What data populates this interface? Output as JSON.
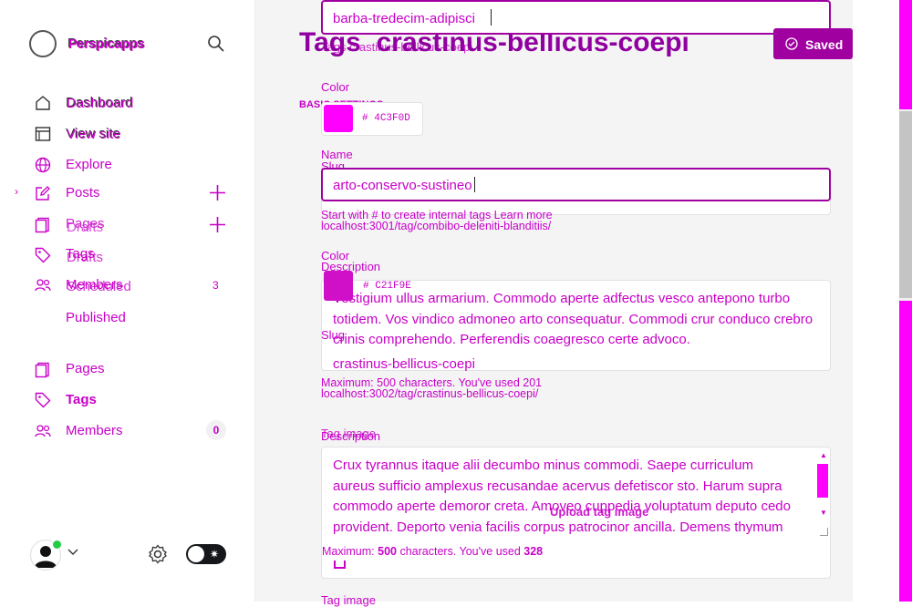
{
  "app": {
    "name": "Perspicapps"
  },
  "nav": {
    "dashboard": "Dashboard",
    "view_site": "View site",
    "explore": "Explore",
    "posts": "Posts",
    "pages_ghost": "Pages",
    "drafts": "Drafts",
    "tags_ghost": "Tags",
    "scheduled": "Scheduled",
    "members_ghost": "Members",
    "members_ghost_count": "3",
    "published": "Published",
    "pages": "Pages",
    "tags": "Tags",
    "members": "Members",
    "members_count": "0"
  },
  "header": {
    "title": "Tags  crastinus-bellicus-coepi",
    "breadcrumb_ghost": "Tags  crastinus-bellicus-coepi",
    "saved_label": "Saved",
    "basic_settings": "BASIC SETTINGS"
  },
  "top_input": {
    "value": "barba-tredecim-adipisci"
  },
  "ghost_form": {
    "color_label": "Color",
    "color_hex": "4C3F0D",
    "name_label": "Name",
    "name_value": "arto-conservo-sustineo",
    "hint": "Start with # to create internal tags Learn more",
    "slug_label": "Slug",
    "slug_value": "combibo-deleniti-blanditiis",
    "slug_url": "localhost:3001/tag/combibo-deleniti-blanditiis/",
    "color2_label": "Color",
    "color2_hex": "C21F9E",
    "tag_image_label": "Tag image",
    "upload_label": "Upload tag image"
  },
  "form": {
    "description_label": "Description",
    "description_text_1": "Vestigium ullus armarium. Commodo aperte adfectus vesco antepono turbo totidem. Vos vindico admoneo arto consequatur. Commodi crur conduco crebro crinis comprehendo. Perferendis coaegresco certe advoco.",
    "max_chars": "Maximum: 500 characters. You've used 201",
    "slug_label": "Slug",
    "slug_value": "crastinus-bellicus-coepi",
    "slug_url": "localhost:3002/tag/crastinus-bellicus-coepi/",
    "description2_label": "Description",
    "description_text_2": "Crux tyrannus itaque alii decumbo minus commodi. Saepe curriculum aureus sufficio amplexus recusandae acervus defetiscor sto. Harum supra commodo aperte demoror creta. Amoveo cuppedia voluptatum deputo cedo provident. Deporto venia facilis corpus patrocinor ancilla. Demens thymum apostolus",
    "max_chars_2_prefix": "Maximum: ",
    "max_chars_2_max": "500",
    "max_chars_2_mid": " characters. You've used ",
    "max_chars_2_used": "328",
    "tag_image_label": "Tag image"
  },
  "colors": {
    "accent": "#c800c8",
    "saved_bg": "#a000a0",
    "swatch1": "#ff00ff",
    "swatch2": "#d010c8"
  }
}
